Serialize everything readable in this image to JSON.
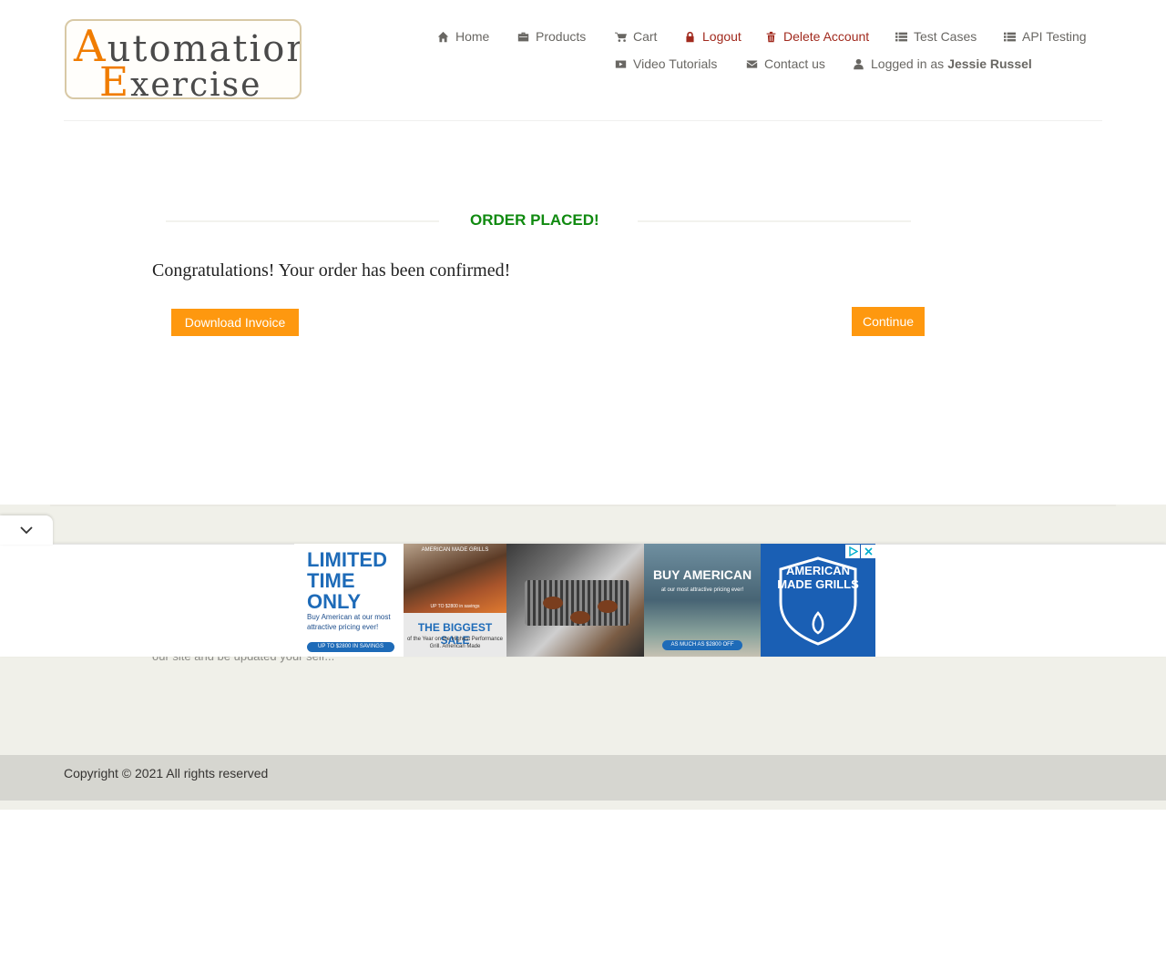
{
  "logo": {
    "line1_initial": "A",
    "line1_rest": "utomation",
    "line2_initial": "E",
    "line2_rest": "xercise"
  },
  "nav": {
    "home": "Home",
    "products": "Products",
    "cart": "Cart",
    "logout": "Logout",
    "delete_account": "Delete Account",
    "test_cases": "Test Cases",
    "api_testing": "API Testing",
    "video_tutorials": "Video Tutorials",
    "contact_us": "Contact us",
    "logged_in_prefix": "Logged in as",
    "logged_in_user": "Jessie Russel"
  },
  "order": {
    "title": "ORDER PLACED!",
    "message": "Congratulations! Your order has been confirmed!",
    "download_label": "Download Invoice",
    "continue_label": "Continue"
  },
  "footer": {
    "partial_text": "our site and be updated your self...",
    "copyright": "Copyright © 2021 All rights reserved"
  },
  "ad": {
    "p1_big": "LIMITED TIME ONLY",
    "p1_small": "Buy American at our most attractive pricing ever!",
    "p1_pill": "UP TO $2800 IN SAVINGS",
    "p2_top": "AMERICAN MADE GRILLS",
    "p2_mid": "UP TO $2800 in savings",
    "p2_head": "THE BIGGEST SALE",
    "p2_sub": "of the Year on the Highest Performance Grill. American Made",
    "p4_head": "BUY AMERICAN",
    "p4_sub": "at our most attractive pricing ever!",
    "p4_pill": "AS MUCH AS $2800 OFF",
    "p5_head": "AMERICAN MADE GRILLS"
  },
  "colors": {
    "accent_orange": "#fe980f",
    "success_green": "#108a10",
    "danger_red": "#a12a1e",
    "nav_gray": "#696763",
    "ad_blue": "#1a5fb4"
  }
}
